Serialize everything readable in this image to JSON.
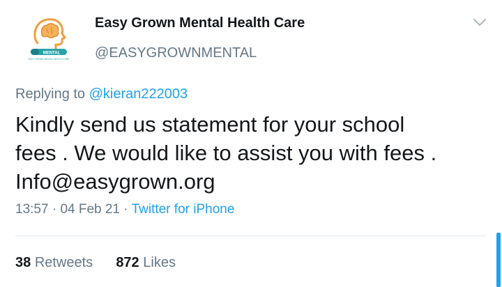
{
  "author": {
    "name": "Easy Grown Mental Health Care",
    "handle": "@EASYGROWNMENTAL",
    "logo_badge": "MENTAL",
    "logo_subtext": "EASY GROWN MENTAL HEALTH CARE"
  },
  "reply": {
    "prefix": "Replying to",
    "mention": "@kieran222003"
  },
  "tweet": {
    "lines": [
      "Kindly send us statement for your school",
      "fees . We would like to assist you with fees .",
      "Info@easygrown.org"
    ]
  },
  "meta": {
    "time": "13:57",
    "sep1": " · ",
    "date": "04 Feb 21",
    "sep2": " · ",
    "source": "Twitter for iPhone"
  },
  "stats": {
    "retweets_count": "38",
    "retweets_label": "Retweets",
    "likes_count": "872",
    "likes_label": "Likes"
  },
  "colors": {
    "accent": "#1da1f2",
    "secondary_text": "#657786",
    "primary_text": "#14171a",
    "logo_orange": "#f39c3d",
    "logo_teal": "#2aa3a8"
  },
  "icons": {
    "menu": "chevron-down-icon",
    "avatar": "brain-head-logo-icon"
  }
}
